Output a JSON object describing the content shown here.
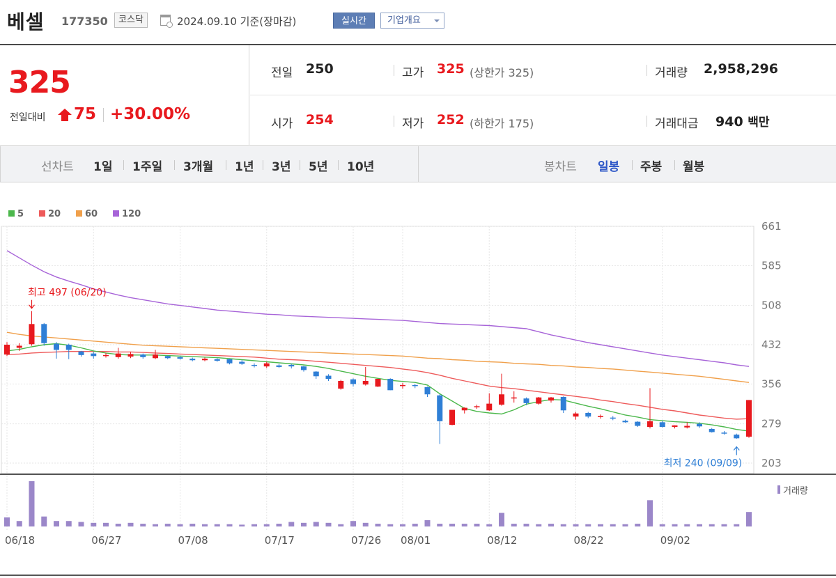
{
  "header": {
    "name": "베셀",
    "code": "177350",
    "market": "코스닥",
    "date": "2024.09.10",
    "basis": "기준(장마감)",
    "live_button": "실시간",
    "overview_button": "기업개요"
  },
  "quote": {
    "price": "325",
    "change_label": "전일대비",
    "change": "75",
    "change_pct": "+30.00%",
    "prev_close_label": "전일",
    "prev_close": "250",
    "high_label": "고가",
    "high": "325",
    "upper_limit": "(상한가 325)",
    "volume_label": "거래량",
    "volume": "2,958,296",
    "open_label": "시가",
    "open": "254",
    "low_label": "저가",
    "low": "252",
    "lower_limit": "(하한가 175)",
    "value_label": "거래대금",
    "value": "940",
    "value_unit": "백만"
  },
  "tabs": {
    "line_chart_label": "선차트",
    "periods": [
      "1일",
      "1주일",
      "3개월",
      "1년",
      "3년",
      "5년",
      "10년"
    ],
    "candle_chart_label": "봉차트",
    "candle_periods": [
      "일봉",
      "주봉",
      "월봉"
    ],
    "active_candle": "일봉"
  },
  "colors": {
    "up": "#e8191e",
    "down": "#2f7fd6",
    "ma5": "#4cb84c",
    "ma20": "#ee5b5b",
    "ma60": "#f0a04b",
    "ma120": "#a764d8",
    "volume": "#9b87c9"
  },
  "chart_data": {
    "type": "candlestick",
    "ylim": [
      203,
      661
    ],
    "y_ticks": [
      "661",
      "585",
      "508",
      "432",
      "356",
      "279",
      "203"
    ],
    "x_tick_labels": [
      "06/18",
      "06/27",
      "07/08",
      "07/17",
      "07/26",
      "08/01",
      "08/12",
      "08/22",
      "09/02"
    ],
    "x_tick_index": [
      0,
      7,
      14,
      21,
      28,
      32,
      39,
      46,
      53
    ],
    "legend": [
      {
        "name": "5",
        "color": "#4cb84c"
      },
      {
        "name": "20",
        "color": "#ee5b5b"
      },
      {
        "name": "60",
        "color": "#f0a04b"
      },
      {
        "name": "120",
        "color": "#a764d8"
      }
    ],
    "volume_label": "거래량",
    "annotations": {
      "high_text": "최고 497 (06/20)",
      "high_index": 2,
      "high_value": 497,
      "low_text": "최저 240 (09/09)",
      "low_index": 59,
      "low_value": 240
    },
    "candles": [
      {
        "o": 413,
        "h": 437,
        "l": 410,
        "c": 432
      },
      {
        "o": 426,
        "h": 435,
        "l": 420,
        "c": 430
      },
      {
        "o": 433,
        "h": 497,
        "l": 430,
        "c": 472
      },
      {
        "o": 472,
        "h": 474,
        "l": 430,
        "c": 435
      },
      {
        "o": 434,
        "h": 437,
        "l": 405,
        "c": 422
      },
      {
        "o": 432,
        "h": 434,
        "l": 404,
        "c": 422
      },
      {
        "o": 419,
        "h": 420,
        "l": 409,
        "c": 412
      },
      {
        "o": 415,
        "h": 418,
        "l": 405,
        "c": 410
      },
      {
        "o": 410,
        "h": 416,
        "l": 407,
        "c": 412
      },
      {
        "o": 408,
        "h": 426,
        "l": 405,
        "c": 415
      },
      {
        "o": 409,
        "h": 418,
        "l": 406,
        "c": 414
      },
      {
        "o": 413,
        "h": 415,
        "l": 405,
        "c": 408
      },
      {
        "o": 406,
        "h": 422,
        "l": 404,
        "c": 413
      },
      {
        "o": 410,
        "h": 411,
        "l": 404,
        "c": 406
      },
      {
        "o": 408,
        "h": 410,
        "l": 403,
        "c": 405
      },
      {
        "o": 405,
        "h": 407,
        "l": 400,
        "c": 402
      },
      {
        "o": 402,
        "h": 407,
        "l": 400,
        "c": 405
      },
      {
        "o": 404,
        "h": 406,
        "l": 399,
        "c": 401
      },
      {
        "o": 404,
        "h": 405,
        "l": 394,
        "c": 396
      },
      {
        "o": 399,
        "h": 402,
        "l": 393,
        "c": 395
      },
      {
        "o": 393,
        "h": 396,
        "l": 388,
        "c": 391
      },
      {
        "o": 390,
        "h": 399,
        "l": 387,
        "c": 396
      },
      {
        "o": 392,
        "h": 395,
        "l": 387,
        "c": 389
      },
      {
        "o": 393,
        "h": 395,
        "l": 386,
        "c": 390
      },
      {
        "o": 390,
        "h": 391,
        "l": 380,
        "c": 383
      },
      {
        "o": 380,
        "h": 381,
        "l": 366,
        "c": 371
      },
      {
        "o": 372,
        "h": 375,
        "l": 362,
        "c": 366
      },
      {
        "o": 347,
        "h": 364,
        "l": 345,
        "c": 362
      },
      {
        "o": 365,
        "h": 367,
        "l": 351,
        "c": 356
      },
      {
        "o": 355,
        "h": 389,
        "l": 353,
        "c": 362
      },
      {
        "o": 351,
        "h": 364,
        "l": 350,
        "c": 366
      },
      {
        "o": 366,
        "h": 367,
        "l": 344,
        "c": 344
      },
      {
        "o": 352,
        "h": 358,
        "l": 347,
        "c": 354
      },
      {
        "o": 354,
        "h": 356,
        "l": 348,
        "c": 352
      },
      {
        "o": 350,
        "h": 351,
        "l": 331,
        "c": 336
      },
      {
        "o": 334,
        "h": 336,
        "l": 240,
        "c": 284
      },
      {
        "o": 277,
        "h": 302,
        "l": 276,
        "c": 306
      },
      {
        "o": 305,
        "h": 311,
        "l": 299,
        "c": 310
      },
      {
        "o": 311,
        "h": 316,
        "l": 308,
        "c": 313
      },
      {
        "o": 305,
        "h": 338,
        "l": 304,
        "c": 318
      },
      {
        "o": 316,
        "h": 376,
        "l": 314,
        "c": 336
      },
      {
        "o": 330,
        "h": 342,
        "l": 320,
        "c": 330
      },
      {
        "o": 328,
        "h": 330,
        "l": 315,
        "c": 319
      },
      {
        "o": 318,
        "h": 331,
        "l": 316,
        "c": 330
      },
      {
        "o": 324,
        "h": 331,
        "l": 320,
        "c": 330
      },
      {
        "o": 331,
        "h": 332,
        "l": 300,
        "c": 305
      },
      {
        "o": 293,
        "h": 302,
        "l": 287,
        "c": 299
      },
      {
        "o": 300,
        "h": 302,
        "l": 290,
        "c": 293
      },
      {
        "o": 293,
        "h": 297,
        "l": 289,
        "c": 294
      },
      {
        "o": 291,
        "h": 294,
        "l": 286,
        "c": 289
      },
      {
        "o": 285,
        "h": 287,
        "l": 281,
        "c": 282
      },
      {
        "o": 283,
        "h": 284,
        "l": 273,
        "c": 275
      },
      {
        "o": 273,
        "h": 348,
        "l": 270,
        "c": 284
      },
      {
        "o": 282,
        "h": 285,
        "l": 272,
        "c": 273
      },
      {
        "o": 273,
        "h": 276,
        "l": 270,
        "c": 276
      },
      {
        "o": 272,
        "h": 282,
        "l": 270,
        "c": 275
      },
      {
        "o": 279,
        "h": 282,
        "l": 271,
        "c": 274
      },
      {
        "o": 269,
        "h": 271,
        "l": 262,
        "c": 263
      },
      {
        "o": 262,
        "h": 265,
        "l": 258,
        "c": 260
      },
      {
        "o": 258,
        "h": 260,
        "l": 250,
        "c": 251
      },
      {
        "o": 254,
        "h": 325,
        "l": 252,
        "c": 325
      }
    ],
    "ma5": [
      420,
      423,
      428,
      432,
      434,
      431,
      426,
      420,
      416,
      413,
      412,
      412,
      412,
      411,
      410,
      409,
      408,
      407,
      405,
      403,
      401,
      399,
      397,
      395,
      393,
      390,
      386,
      381,
      376,
      371,
      367,
      363,
      361,
      359,
      354,
      337,
      323,
      309,
      303,
      300,
      298,
      306,
      317,
      322,
      326,
      325,
      319,
      313,
      308,
      302,
      296,
      292,
      287,
      285,
      283,
      282,
      280,
      277,
      273,
      268,
      265
    ],
    "ma20": [
      413,
      414,
      416,
      417,
      418,
      419,
      419,
      419,
      419,
      418,
      418,
      417,
      416,
      415,
      414,
      413,
      412,
      411,
      410,
      409,
      408,
      406,
      404,
      403,
      402,
      400,
      398,
      396,
      394,
      392,
      390,
      388,
      385,
      382,
      378,
      373,
      367,
      362,
      357,
      352,
      349,
      347,
      344,
      341,
      338,
      335,
      332,
      329,
      325,
      322,
      318,
      315,
      311,
      307,
      304,
      300,
      296,
      293,
      290,
      288,
      289
    ],
    "ma60": [
      456,
      452,
      449,
      447,
      445,
      443,
      441,
      439,
      437,
      435,
      433,
      431,
      430,
      429,
      428,
      427,
      426,
      425,
      424,
      423,
      422,
      421,
      420,
      419,
      418,
      417,
      416,
      415,
      414,
      413,
      412,
      411,
      410,
      408,
      406,
      405,
      403,
      402,
      400,
      399,
      398,
      396,
      395,
      394,
      392,
      391,
      389,
      388,
      386,
      385,
      383,
      381,
      379,
      377,
      375,
      373,
      371,
      368,
      365,
      362,
      359
    ],
    "ma120": [
      614,
      600,
      586,
      573,
      563,
      555,
      548,
      540,
      534,
      528,
      523,
      519,
      515,
      511,
      508,
      505,
      502,
      499,
      497,
      495,
      493,
      491,
      490,
      488,
      487,
      486,
      485,
      484,
      483,
      482,
      481,
      480,
      479,
      477,
      475,
      473,
      472,
      471,
      470,
      469,
      467,
      465,
      463,
      457,
      451,
      446,
      441,
      436,
      432,
      428,
      424,
      420,
      416,
      412,
      409,
      406,
      403,
      400,
      397,
      393,
      390
    ],
    "volume": [
      0.2,
      0.12,
      1.0,
      0.22,
      0.12,
      0.12,
      0.1,
      0.08,
      0.08,
      0.06,
      0.08,
      0.06,
      0.05,
      0.06,
      0.05,
      0.06,
      0.05,
      0.05,
      0.05,
      0.04,
      0.05,
      0.05,
      0.06,
      0.1,
      0.08,
      0.1,
      0.08,
      0.05,
      0.12,
      0.08,
      0.06,
      0.05,
      0.05,
      0.06,
      0.14,
      0.06,
      0.06,
      0.06,
      0.06,
      0.05,
      0.3,
      0.06,
      0.06,
      0.05,
      0.06,
      0.05,
      0.05,
      0.05,
      0.05,
      0.05,
      0.05,
      0.06,
      0.58,
      0.05,
      0.05,
      0.05,
      0.05,
      0.05,
      0.05,
      0.05,
      0.32
    ]
  }
}
